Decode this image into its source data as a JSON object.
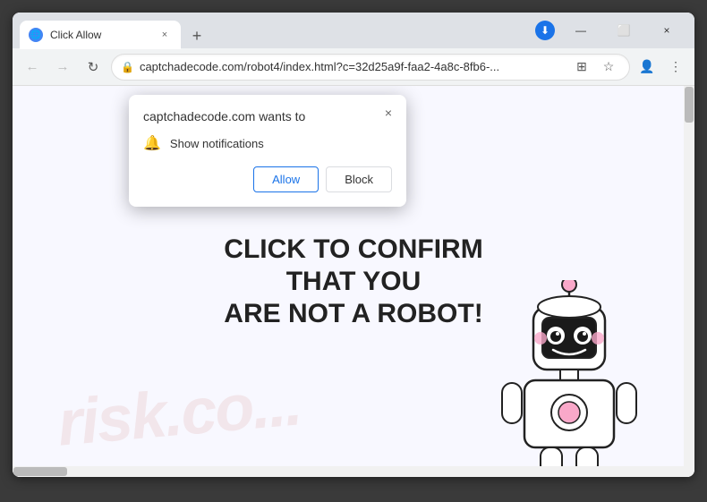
{
  "browser": {
    "tab": {
      "favicon_char": "🌐",
      "title": "Click Allow",
      "close_char": "×"
    },
    "new_tab_char": "+",
    "address": {
      "lock_char": "🔒",
      "url": "captchadecode.com/robot4/index.html?c=32d25a9f-faa2-4a8c-8fb6-...",
      "translate_char": "⊞",
      "bookmark_char": "☆",
      "profile_char": "👤",
      "menu_char": "⋮"
    },
    "nav": {
      "back_char": "←",
      "forward_char": "→",
      "reload_char": "↻"
    },
    "window_controls": {
      "minimize": "—",
      "maximize": "⬜",
      "close": "×"
    }
  },
  "page": {
    "main_text_line1": "CLICK",
    "main_text_line2": "T YOU",
    "main_text_bold": "ARE NOT A ROBOT!",
    "watermark": "risk.co..."
  },
  "popup": {
    "title": "captchadecode.com wants to",
    "close_char": "×",
    "permission_icon": "🔔",
    "permission_text": "Show notifications",
    "allow_label": "Allow",
    "block_label": "Block"
  }
}
